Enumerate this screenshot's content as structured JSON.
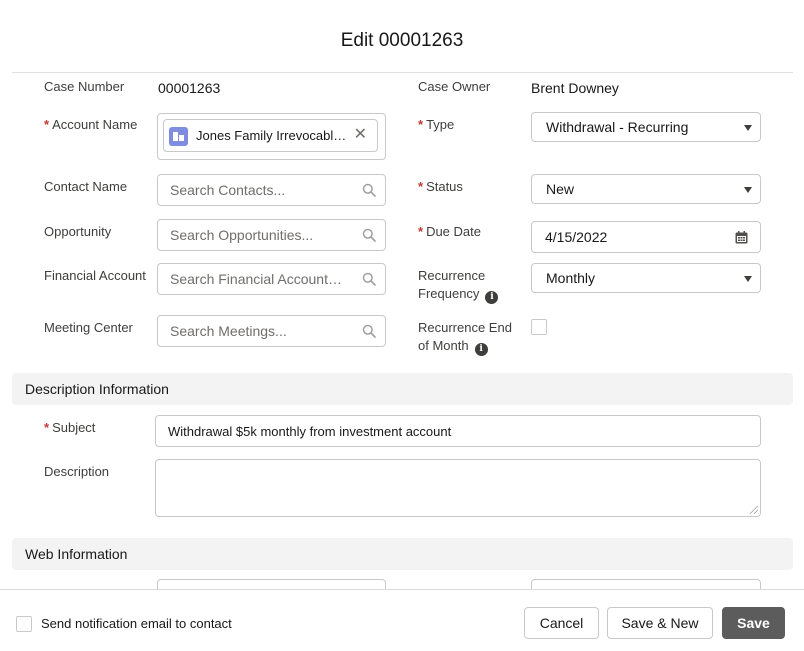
{
  "modal": {
    "title": "Edit 00001263"
  },
  "fields": {
    "case_number": {
      "label": "Case Number",
      "value": "00001263"
    },
    "case_owner": {
      "label": "Case Owner",
      "value": "Brent Downey"
    },
    "account_name": {
      "label": "Account Name",
      "required": true,
      "value": "Jones Family Irrevocable Trust",
      "icon": "account-icon"
    },
    "type": {
      "label": "Type",
      "required": true,
      "value": "Withdrawal - Recurring"
    },
    "contact_name": {
      "label": "Contact Name",
      "placeholder": "Search Contacts..."
    },
    "status": {
      "label": "Status",
      "required": true,
      "value": "New"
    },
    "opportunity": {
      "label": "Opportunity",
      "placeholder": "Search Opportunities..."
    },
    "due_date": {
      "label": "Due Date",
      "required": true,
      "value": "4/15/2022"
    },
    "financial_account": {
      "label": "Financial Account",
      "placeholder": "Search Financial Accounts..."
    },
    "recurrence_frequency": {
      "label_line1": "Recurrence",
      "label_line2": "Frequency",
      "value": "Monthly"
    },
    "meeting_center": {
      "label": "Meeting Center",
      "placeholder": "Search Meetings..."
    },
    "recurrence_end_of_month": {
      "label_line1": "Recurrence End",
      "label_line2": "of Month",
      "checked": false
    }
  },
  "sections": {
    "description": {
      "header": "Description Information",
      "subject": {
        "label": "Subject",
        "required": true,
        "value": "Withdrawal $5k monthly from investment account"
      },
      "description": {
        "label": "Description",
        "value": ""
      }
    },
    "web": {
      "header": "Web Information"
    }
  },
  "footer": {
    "notify_label": "Send notification email to contact",
    "notify_checked": false,
    "cancel_label": "Cancel",
    "save_new_label": "Save & New",
    "save_label": "Save"
  },
  "icons": {
    "search": "search-icon",
    "calendar": "calendar-icon",
    "info": "info-icon",
    "close": "close-icon",
    "caret": "chevron-down-icon"
  },
  "colors": {
    "required": "#c23934",
    "primary_button": "#5c5c5c",
    "account_icon": "#7f8de1",
    "section_bg": "#f3f3f3"
  }
}
